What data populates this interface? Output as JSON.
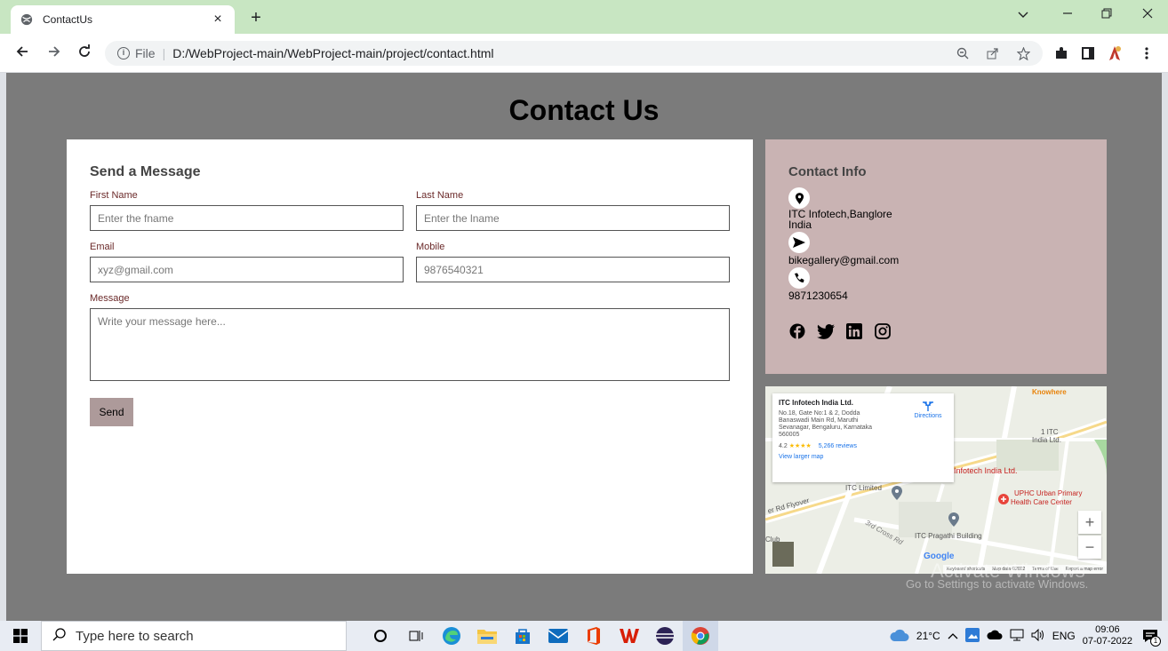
{
  "browser": {
    "tab_title": "ContactUs",
    "tab_close": "×",
    "new_tab": "+",
    "url_scheme": "File",
    "url_path": "D:/WebProject-main/WebProject-main/project/contact.html",
    "accent": "#c8e6c2"
  },
  "page": {
    "title": "Contact Us",
    "form": {
      "heading": "Send a Message",
      "first_name_label": "First Name",
      "first_name_placeholder": "Enter the fname",
      "last_name_label": "Last Name",
      "last_name_placeholder": "Enter the lname",
      "email_label": "Email",
      "email_placeholder": "xyz@gmail.com",
      "mobile_label": "Mobile",
      "mobile_placeholder": "9876540321",
      "message_label": "Message",
      "message_placeholder": "Write your message here...",
      "send_label": "Send"
    },
    "info": {
      "heading": "Contact Info",
      "address_line1": "ITC Infotech,Banglore",
      "address_line2": "India",
      "email": "bikegallery@gmail.com",
      "phone": "9871230654",
      "background": "#c9b3b3"
    },
    "map": {
      "place_name": "ITC Infotech India Ltd.",
      "place_address": "No.18, Gate No:1 & 2, Dodda Banaswadi Main Rd, Maruthi Sevanagar, Bengaluru, Karnataka 560005",
      "rating": "4.2",
      "stars": "★★★★",
      "reviews": "5,266 reviews",
      "larger_map": "View larger map",
      "directions": "Directions",
      "labels": {
        "knowhere": "Knowhere",
        "itc_india": "1 ITC",
        "itc_india2": "India Ltd.",
        "infotech": "Infotech India Ltd.",
        "itc_limited": "ITC Limited",
        "uphc": "UPHC Urban Primary",
        "uphc2": "Health Care Center",
        "flyover": "er Rd Flyover",
        "pragathi": "ITC Pragathi Building",
        "cross": "3rd Cross Rd",
        "club": "Club"
      },
      "google": "Google",
      "footer_shortcuts": "Keyboard shortcuts",
      "footer_data": "Map data ©2022",
      "footer_terms": "Terms of Use",
      "footer_report": "Report a map error"
    },
    "watermark_title": "Activate Windows",
    "watermark_sub": "Go to Settings to activate Windows."
  },
  "taskbar": {
    "search_placeholder": "Type here to search",
    "weather": "21°C",
    "language": "ENG",
    "time": "09:06",
    "date": "07-07-2022",
    "notification_count": "1"
  }
}
